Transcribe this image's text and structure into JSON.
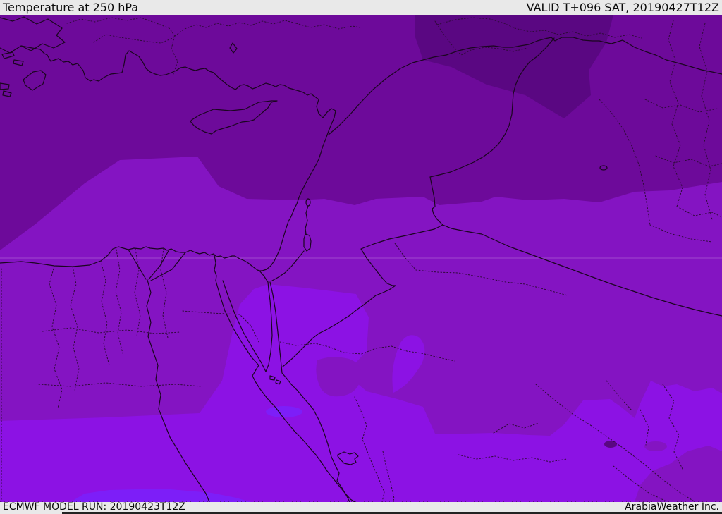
{
  "header": {
    "title": "Temperature at 250 hPa",
    "valid": "VALID T+096 SAT, 20190427T12Z"
  },
  "footer": {
    "model_run": "ECMWF MODEL RUN: 20190423T12Z",
    "branding": "ArabiaWeather Inc."
  },
  "map": {
    "colors": {
      "band_darkest": "#5a0782",
      "band_dark": "#6d0a9a",
      "band_medium": "#8414c2",
      "band_bright": "#8c12e4",
      "band_brightest": "#7d1ef8",
      "border_solid": "#1b0520",
      "border_admin": "#2e0a38",
      "graticule": "rgba(255,255,255,0.22)"
    },
    "chrome": {
      "bar_background": "#e9e9e9",
      "bar_text": "#0a0a0a",
      "edge_strip": "#232323"
    }
  }
}
